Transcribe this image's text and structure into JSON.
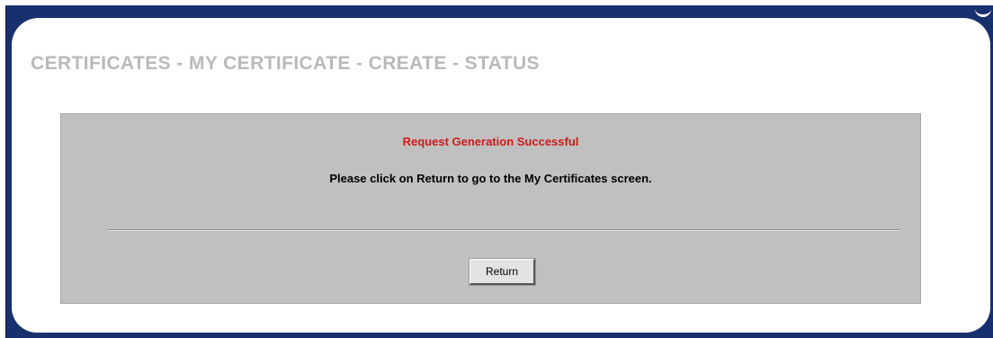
{
  "page": {
    "title": "CERTIFICATES - MY CERTIFICATE - CREATE - STATUS"
  },
  "status": {
    "message": "Request Generation Successful",
    "instruction": "Please click on Return to go to the My Certificates screen."
  },
  "actions": {
    "return_label": "Return"
  },
  "colors": {
    "frame": "#19306e",
    "title": "#b9b9b9",
    "status_box": "#c0c0c0",
    "success_message": "#d01a1a"
  }
}
